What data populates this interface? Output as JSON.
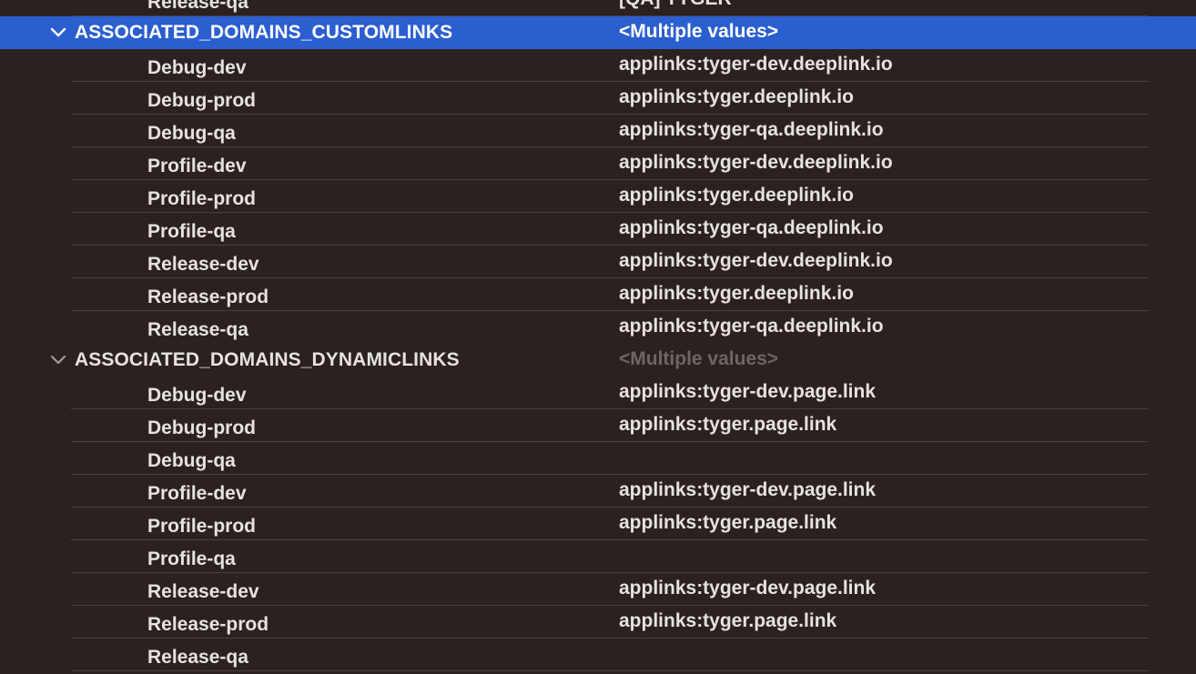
{
  "top_row": {
    "key": "Release-qa",
    "value": "[QA] TYGER"
  },
  "groups": [
    {
      "key": "ASSOCIATED_DOMAINS_CUSTOMLINKS",
      "value": "<Multiple values>",
      "selected": true,
      "rows": [
        {
          "key": "Debug-dev",
          "value": "applinks:tyger-dev.deeplink.io"
        },
        {
          "key": "Debug-prod",
          "value": "applinks:tyger.deeplink.io"
        },
        {
          "key": "Debug-qa",
          "value": "applinks:tyger-qa.deeplink.io"
        },
        {
          "key": "Profile-dev",
          "value": "applinks:tyger-dev.deeplink.io"
        },
        {
          "key": "Profile-prod",
          "value": "applinks:tyger.deeplink.io"
        },
        {
          "key": "Profile-qa",
          "value": "applinks:tyger-qa.deeplink.io"
        },
        {
          "key": "Release-dev",
          "value": "applinks:tyger-dev.deeplink.io"
        },
        {
          "key": "Release-prod",
          "value": "applinks:tyger.deeplink.io"
        },
        {
          "key": "Release-qa",
          "value": "applinks:tyger-qa.deeplink.io"
        }
      ]
    },
    {
      "key": "ASSOCIATED_DOMAINS_DYNAMICLINKS",
      "value": "<Multiple values>",
      "selected": false,
      "rows": [
        {
          "key": "Debug-dev",
          "value": "applinks:tyger-dev.page.link"
        },
        {
          "key": "Debug-prod",
          "value": "applinks:tyger.page.link"
        },
        {
          "key": "Debug-qa",
          "value": ""
        },
        {
          "key": "Profile-dev",
          "value": "applinks:tyger-dev.page.link"
        },
        {
          "key": "Profile-prod",
          "value": "applinks:tyger.page.link"
        },
        {
          "key": "Profile-qa",
          "value": ""
        },
        {
          "key": "Release-dev",
          "value": "applinks:tyger-dev.page.link"
        },
        {
          "key": "Release-prod",
          "value": "applinks:tyger.page.link"
        },
        {
          "key": "Release-qa",
          "value": ""
        }
      ]
    }
  ],
  "icons": {
    "disclosure": "chevron-down-icon"
  },
  "colors": {
    "background": "#2b2220",
    "selection": "#2b5fd0",
    "text": "#e6e2df",
    "dim": "#6f6664",
    "separator": "#4a403d"
  }
}
